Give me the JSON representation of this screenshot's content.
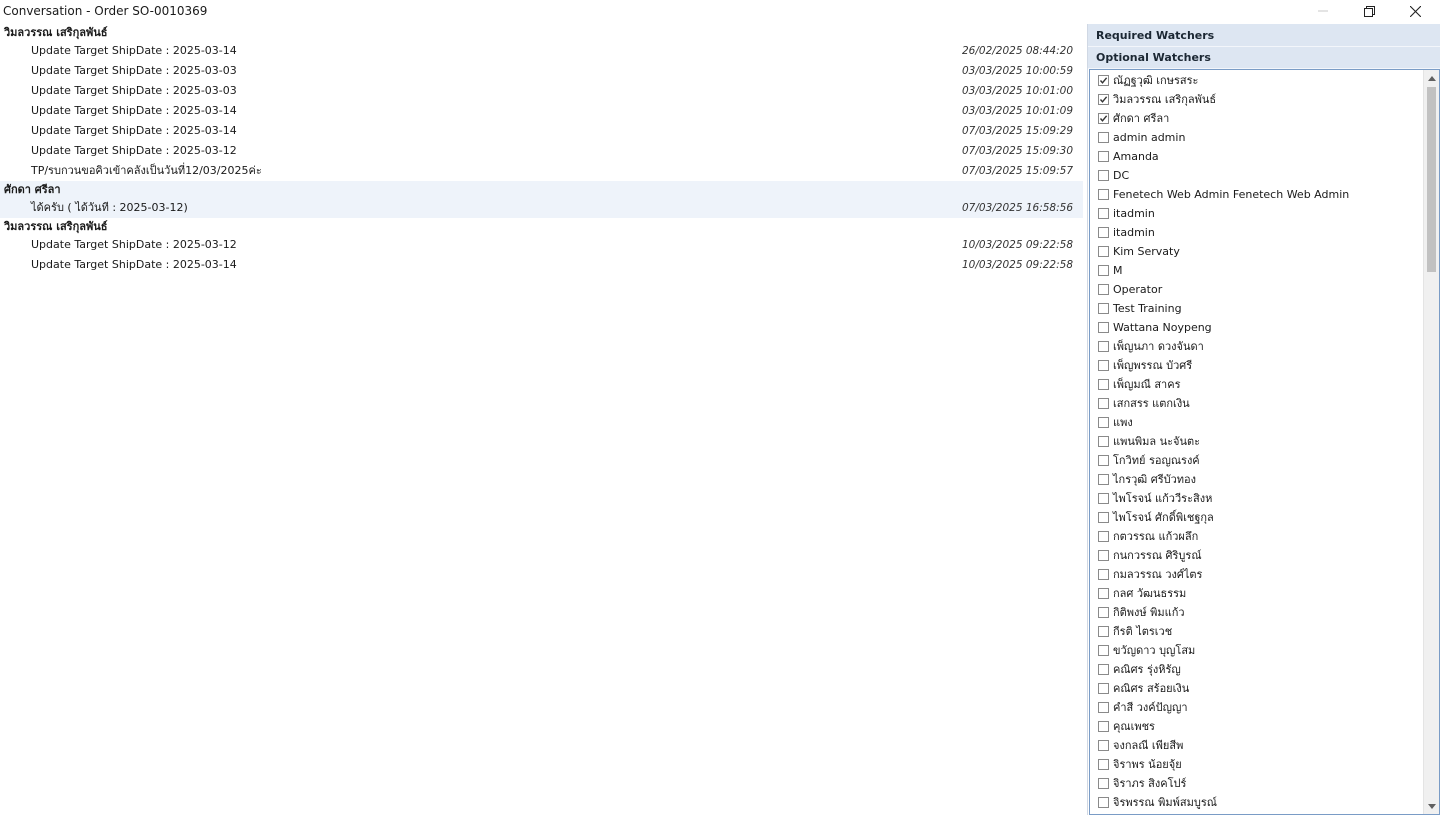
{
  "window": {
    "title": "Conversation - Order SO-0010369",
    "minimize_icon": "minimize-icon",
    "restore_icon": "restore-icon",
    "close_icon": "close-icon"
  },
  "conversation": {
    "groups": [
      {
        "author": "วิมลวรรณ เสริกุลพันธ์",
        "messages": [
          {
            "text": "Update Target ShipDate : 2025-03-14",
            "time": "26/02/2025 08:44:20"
          },
          {
            "text": "Update Target ShipDate : 2025-03-03",
            "time": "03/03/2025 10:00:59"
          },
          {
            "text": "Update Target ShipDate : 2025-03-03",
            "time": "03/03/2025 10:01:00"
          },
          {
            "text": "Update Target ShipDate : 2025-03-14",
            "time": "03/03/2025 10:01:09"
          },
          {
            "text": "Update Target ShipDate : 2025-03-14",
            "time": "07/03/2025 15:09:29"
          },
          {
            "text": "Update Target ShipDate : 2025-03-12",
            "time": "07/03/2025 15:09:30"
          },
          {
            "text": "TP/รบกวนขอคิวเข้าคลังเป็นวันที่12/03/2025ค่ะ",
            "time": "07/03/2025 15:09:57"
          }
        ]
      },
      {
        "author": "ศักดา ศรีลา",
        "selected": true,
        "messages": [
          {
            "text": "ได้ครับ ( ได้วันที : 2025-03-12)",
            "time": "07/03/2025 16:58:56"
          }
        ]
      },
      {
        "author": "วิมลวรรณ เสริกุลพันธ์",
        "messages": [
          {
            "text": "Update Target ShipDate : 2025-03-12",
            "time": "10/03/2025 09:22:58"
          },
          {
            "text": "Update Target ShipDate : 2025-03-14",
            "time": "10/03/2025 09:22:58"
          }
        ]
      }
    ]
  },
  "watchers": {
    "required_title": "Required Watchers",
    "optional_title": "Optional Watchers",
    "check_icon": "checkmark-icon",
    "items": [
      {
        "label": "ณัฏฐวุฒิ เกษรสระ",
        "checked": true
      },
      {
        "label": "วิมลวรรณ เสริกุลพันธ์",
        "checked": true
      },
      {
        "label": "ศักดา ศรีลา",
        "checked": true
      },
      {
        "label": "admin admin",
        "checked": false
      },
      {
        "label": "Amanda",
        "checked": false
      },
      {
        "label": "DC",
        "checked": false
      },
      {
        "label": "Fenetech Web Admin Fenetech Web Admin",
        "checked": false
      },
      {
        "label": "itadmin",
        "checked": false
      },
      {
        "label": "itadmin",
        "checked": false
      },
      {
        "label": "Kim Servaty",
        "checked": false
      },
      {
        "label": "M",
        "checked": false
      },
      {
        "label": "Operator",
        "checked": false
      },
      {
        "label": "Test Training",
        "checked": false
      },
      {
        "label": "Wattana Noypeng",
        "checked": false
      },
      {
        "label": "เพ็ญนภา ดวงจันดา",
        "checked": false
      },
      {
        "label": "เพ็ญพรรณ บัวศรี",
        "checked": false
      },
      {
        "label": "เพ็ญมณี สาคร",
        "checked": false
      },
      {
        "label": "เสกสรร แตกเงิน",
        "checked": false
      },
      {
        "label": "แพง",
        "checked": false
      },
      {
        "label": "แพนพิมล นะจันตะ",
        "checked": false
      },
      {
        "label": "โกวิทย์ รอญณรงค์",
        "checked": false
      },
      {
        "label": "ไกรวุฒิ ศรีบัวทอง",
        "checked": false
      },
      {
        "label": "ไพโรจน์ แก้ววีระสิงห",
        "checked": false
      },
      {
        "label": "ไพโรจน์ ศักดิ์พิเชฐกุล",
        "checked": false
      },
      {
        "label": "กตวรรณ แก้วผลึก",
        "checked": false
      },
      {
        "label": "กนกวรรณ ศิริบูรณ์",
        "checked": false
      },
      {
        "label": "กมลวรรณ   วงศ์ไตร",
        "checked": false
      },
      {
        "label": "กลศ วัฒนธรรม",
        "checked": false
      },
      {
        "label": "กิติพงษ์   พิมแก้ว",
        "checked": false
      },
      {
        "label": "กีรติ  ไตรเวช",
        "checked": false
      },
      {
        "label": "ขวัญดาว บุญโสม",
        "checked": false
      },
      {
        "label": "คณิศร รุ่งหิรัญ",
        "checked": false
      },
      {
        "label": "คณิศร สร้อยเงิน",
        "checked": false
      },
      {
        "label": "คำสี วงค์ปัญญา",
        "checked": false
      },
      {
        "label": "คุณเพชร",
        "checked": false
      },
      {
        "label": "จงกลณี   เพียสีพ",
        "checked": false
      },
      {
        "label": "จิราพร น้อยจุ้ย",
        "checked": false
      },
      {
        "label": "จิราภร สิงคโปร์",
        "checked": false
      },
      {
        "label": "จิรพรรณ พิมพ์สมบูรณ์",
        "checked": false
      }
    ],
    "scrollbar": {
      "position_fraction": 0.0,
      "up_icon": "scroll-up-arrow-icon",
      "down_icon": "scroll-down-arrow-icon"
    }
  }
}
